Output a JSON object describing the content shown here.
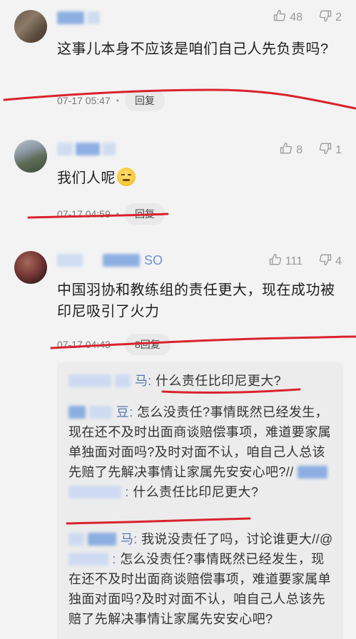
{
  "comments": [
    {
      "username_suffix": "",
      "likes": "48",
      "dislikes": "2",
      "text": "这事儿本身不应该是咱们自己人先负责吗?",
      "time": "07-17 05:47",
      "reply_label": "回复"
    },
    {
      "username_suffix": "",
      "likes": "8",
      "dislikes": "1",
      "text": "我们人呢",
      "time": "07-17 04:59",
      "reply_label": "回复"
    },
    {
      "username_suffix": "SO",
      "likes": "111",
      "dislikes": "4",
      "text": "中国羽协和教练组的责任更大，现在成功被印尼吸引了火力",
      "time": "07-17 04:43",
      "reply_label": "8回复"
    }
  ],
  "replies": [
    {
      "name": "马:",
      "text": "什么责任比印尼更大?"
    },
    {
      "name": "豆:",
      "text": "怎么没责任?事情既然已经发生，现在还不及时出面商谈赔偿事项，难道要家属单独面对面吗?及时对面不认，咱自己人总该先赔了先解决事情让家属先安安心吧?//",
      "tail_name": ":",
      "tail_text": "什么责任比印尼更大?"
    },
    {
      "name": "马:",
      "text": "我说没责任了吗，讨论谁更大//@",
      "mid_name": ":",
      "mid_text": "怎么没责任?事情既然已经发生，现在还不及时出面商谈赔偿事项，难道要家属单独面对面吗?及时对面不认，咱自己人总该先赔了先解决事情让家属先安安心吧?"
    }
  ],
  "colors": {
    "accent_name": "#5677b8",
    "underline": "#d9232d",
    "muted": "#999999"
  },
  "icons": [
    "thumbs-up-icon",
    "thumbs-down-icon"
  ]
}
